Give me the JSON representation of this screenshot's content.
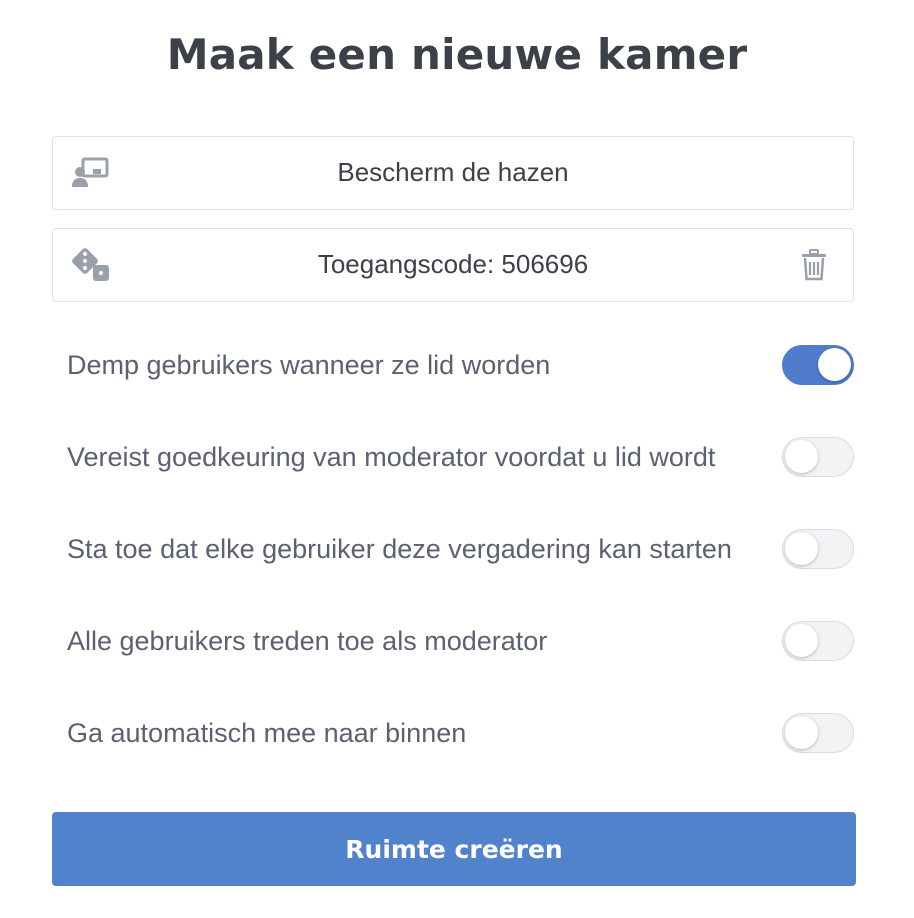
{
  "title": "Maak een nieuwe kamer",
  "room_name": {
    "icon": "room-presentation-icon",
    "value": "Bescherm de hazen"
  },
  "access_code": {
    "icon": "dice-icon",
    "value": "Toegangscode: 506696",
    "delete_icon": "trash-icon"
  },
  "options": [
    {
      "label": "Demp gebruikers wanneer ze lid worden",
      "checked": true
    },
    {
      "label": "Vereist goedkeuring van moderator voordat u lid wordt",
      "checked": false
    },
    {
      "label": "Sta toe dat elke gebruiker deze vergadering kan starten",
      "checked": false
    },
    {
      "label": "Alle gebruikers treden toe als moderator",
      "checked": false
    },
    {
      "label": "Ga automatisch mee naar binnen",
      "checked": false
    }
  ],
  "submit_label": "Ruimte creëren",
  "colors": {
    "accent": "#4f7ccb",
    "button": "#5182cc",
    "text": "#3c4149",
    "label": "#5b6170"
  }
}
